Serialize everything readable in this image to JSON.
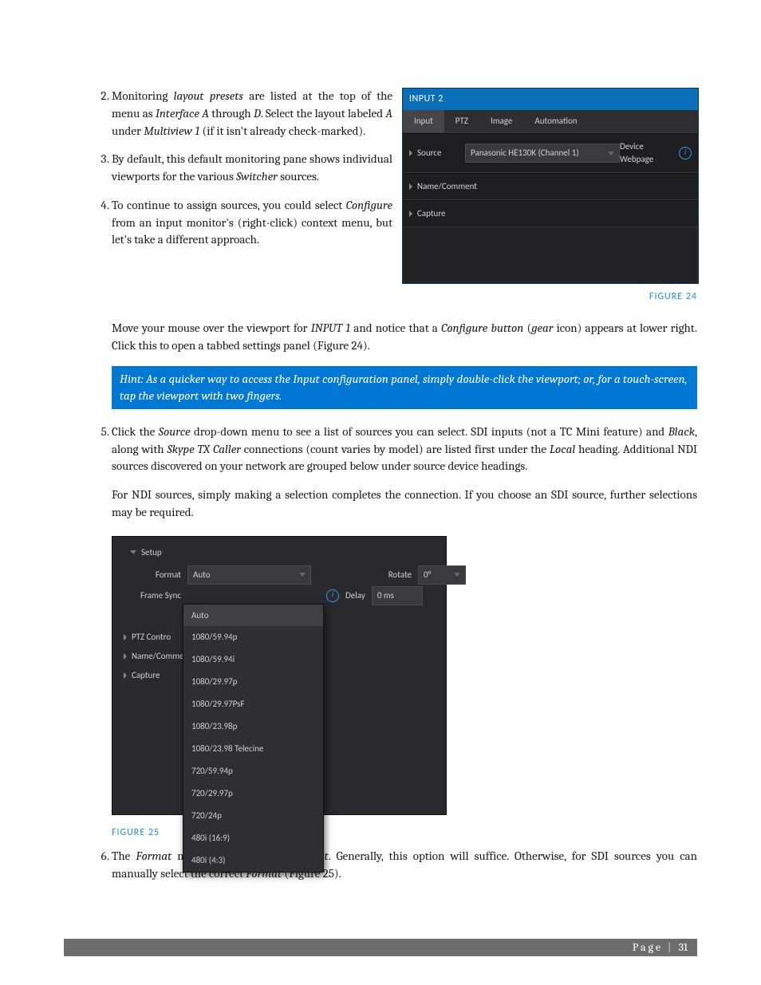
{
  "list": {
    "start": 2,
    "item2": {
      "pre": "Monitoring ",
      "em1": "layout presets",
      "mid1": " are listed at the top of the menu as ",
      "em2": "Interface A",
      "mid2": " through ",
      "em3": "D",
      "mid3": ". Select the layout labeled ",
      "em4": "A",
      "mid4": " under ",
      "em5": "Multiview 1",
      "post": " (if it isn't already check-marked)."
    },
    "item3": {
      "pre": "By default, this default monitoring pane shows individual viewports for the various ",
      "em1": "Switcher",
      "post": " sources."
    },
    "item4": {
      "pre": "To continue to assign sources, you could select ",
      "em1": "Configure",
      "post": " from an input monitor's (right-click) context menu, but let's take a different approach."
    },
    "item5": {
      "p1_pre": "Click the ",
      "p1_em1": "Source",
      "p1_mid1": " drop-down menu to see a list of sources you can select.  SDI inputs (not a TC Mini feature) and ",
      "p1_em2": "Black",
      "p1_mid2": ", along with ",
      "p1_em3": "Skype TX Caller",
      "p1_mid3": " connections (count varies by model) are listed first under the ",
      "p1_em4": "Local",
      "p1_post": " heading.  Additional NDI sources discovered on your network are grouped below under source device headings.",
      "p2": "For NDI sources, simply making a selection completes the connection.  If you choose an SDI source, further selections may be required."
    },
    "item6": {
      "pre": "The ",
      "em1": "Format",
      "mid1": " menu defaults to ",
      "em2": "Auto-Detect",
      "mid2": ". Generally, this option will suffice. Otherwise, for SDI sources you can manually select the correct ",
      "em3": "Format",
      "post": " (Figure 25)."
    }
  },
  "para_after4": {
    "pre": "Move your mouse over the viewport for ",
    "em1": "INPUT 1",
    "mid1": " and notice that a ",
    "em2": "Configure button",
    "mid2": " (",
    "em3": "gear",
    "post": " icon) appears at lower right.  Click this to open a tabbed settings panel (Figure 24)."
  },
  "hint": "Hint: As a quicker way to access the Input configuration panel, simply double-click the viewport; or, for a touch-screen, tap the viewport with two fingers.",
  "fig24": {
    "caption": "FIGURE 24",
    "title": "INPUT 2",
    "tabs": [
      "Input",
      "PTZ",
      "Image",
      "Automation"
    ],
    "source_label": "Source",
    "source_value": "Panasonic HE130K (Channel 1)",
    "device_webpage": "Device Webpage",
    "acc1": "Name/Comment",
    "acc2": "Capture"
  },
  "fig25": {
    "caption": "FIGURE 25",
    "setup": "Setup",
    "format_label": "Format",
    "format_value": "Auto",
    "framesync_label": "Frame Sync",
    "rotate_label": "Rotate",
    "rotate_value": "0°",
    "delay_label": "Delay",
    "delay_value": "0 ms",
    "acc_ptz": "PTZ Contro",
    "acc_name": "Name/Commen",
    "acc_capture": "Capture",
    "menu": [
      "Auto",
      "1080/59.94p",
      "1080/59.94i",
      "1080/29.97p",
      "1080/29.97PsF",
      "1080/23.98p",
      "1080/23.98 Telecine",
      "720/59.94p",
      "720/29.97p",
      "720/24p",
      "480i (16:9)",
      "480i (4:3)"
    ],
    "menu_selected_index": 0
  },
  "footer": {
    "label": "Page",
    "num": "31"
  }
}
